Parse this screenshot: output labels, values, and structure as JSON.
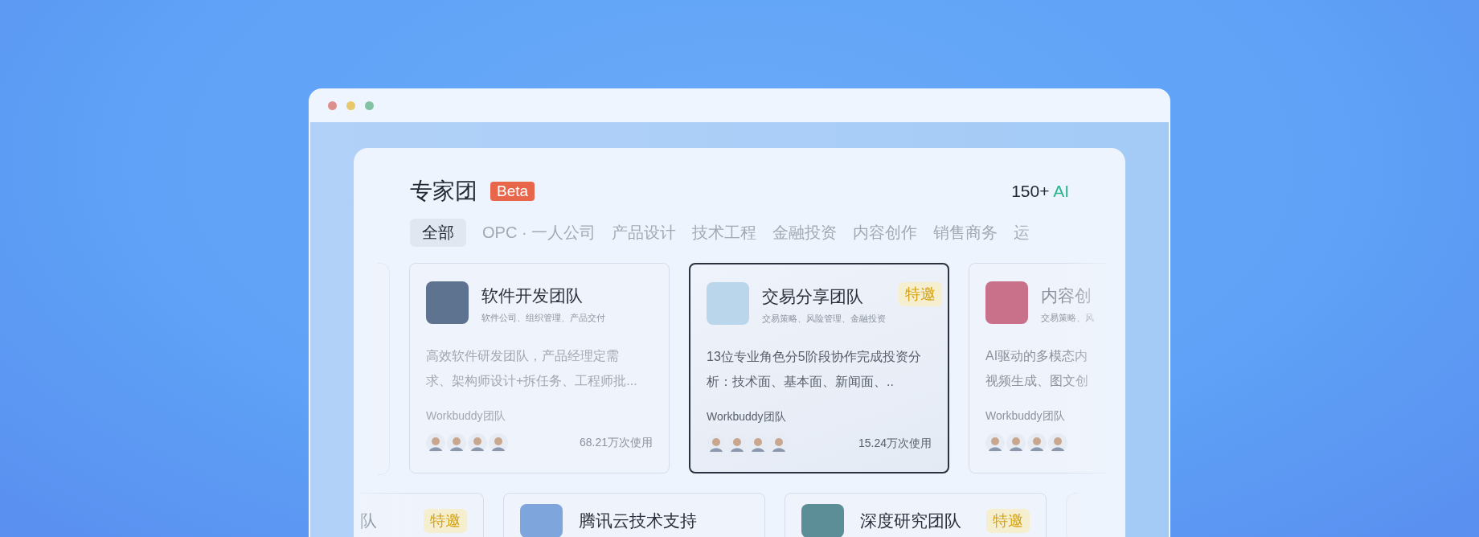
{
  "header": {
    "title": "专家团",
    "badge": "Beta",
    "count": "150+",
    "count_suffix": "AI"
  },
  "tabs": [
    {
      "label": "全部",
      "selected": true
    },
    {
      "label": "OPC · 一人公司",
      "selected": false
    },
    {
      "label": "产品设计",
      "selected": false
    },
    {
      "label": "技术工程",
      "selected": false
    },
    {
      "label": "金融投资",
      "selected": false
    },
    {
      "label": "内容创作",
      "selected": false
    },
    {
      "label": "销售商务",
      "selected": false
    },
    {
      "label": "运",
      "selected": false
    }
  ],
  "cards": [
    {
      "kind": "full",
      "title": "软件开发团队",
      "tags": "软件公司、组织管理、产品交付",
      "description": [
        "高效软件研发团队，产品经理定需",
        "求、架构师设计+拆任务、工程师批..."
      ],
      "author": "Workbuddy团队",
      "uses": "68.21万次使用",
      "selected": false
    },
    {
      "kind": "full",
      "title": "交易分享团队",
      "badge": "特邀",
      "tags": "交易策略、风险管理、金融投资",
      "description": [
        "13位专业角色分5阶段协作完成投资分",
        "析：技术面、基本面、新闻面、.."
      ],
      "author": "Workbuddy团队",
      "uses": "15.24万次使用",
      "selected": true
    },
    {
      "kind": "cut",
      "title": "内容创",
      "tags": "交易策略、风",
      "description": [
        "AI驱动的多模态内",
        "视频生成、图文创"
      ],
      "author": "Workbuddy团队",
      "selected": false
    }
  ],
  "more_cards": [
    {
      "kind": "cut",
      "title": "队",
      "badge": "特邀"
    },
    {
      "kind": "full",
      "title": "腾讯云技术支持"
    },
    {
      "kind": "full",
      "title": "深度研究团队",
      "badge": "特邀"
    }
  ]
}
